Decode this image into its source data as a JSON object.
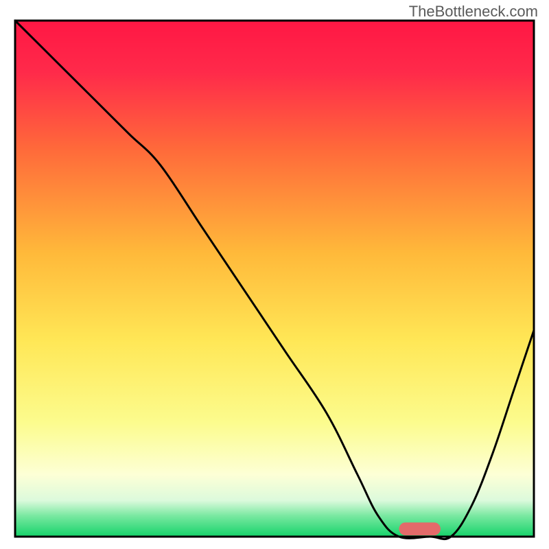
{
  "watermark": "TheBottleneck.com",
  "chart_data": {
    "type": "line",
    "title": "",
    "xlabel": "",
    "ylabel": "",
    "xlim": [
      0,
      100
    ],
    "ylim": [
      0,
      100
    ],
    "background": {
      "type": "vertical-gradient",
      "stops": [
        {
          "offset": 0.0,
          "color": "#ff1744"
        },
        {
          "offset": 0.1,
          "color": "#ff2a4a"
        },
        {
          "offset": 0.25,
          "color": "#ff6a3a"
        },
        {
          "offset": 0.45,
          "color": "#ffb93a"
        },
        {
          "offset": 0.62,
          "color": "#ffe756"
        },
        {
          "offset": 0.78,
          "color": "#fcfc8e"
        },
        {
          "offset": 0.88,
          "color": "#fdffd6"
        },
        {
          "offset": 0.93,
          "color": "#dcfadc"
        },
        {
          "offset": 0.96,
          "color": "#78e8a0"
        },
        {
          "offset": 1.0,
          "color": "#15d36a"
        }
      ]
    },
    "series": [
      {
        "name": "bottleneck-curve",
        "color": "#000000",
        "x": [
          0,
          8,
          16,
          22,
          28,
          36,
          44,
          52,
          60,
          66,
          70,
          74,
          80,
          84,
          88,
          92,
          96,
          100
        ],
        "y": [
          100,
          92,
          84,
          78,
          72,
          60,
          48,
          36,
          24,
          12,
          4,
          0,
          0,
          0,
          6,
          16,
          28,
          40
        ]
      }
    ],
    "marker": {
      "name": "optimal-range",
      "color": "#e36a6a",
      "x_start": 74,
      "x_end": 82,
      "y": 1.5,
      "thickness": 2.5
    },
    "axes": {
      "show_ticks": false,
      "show_labels": false,
      "frame_color": "#000000",
      "frame_width": 3
    }
  }
}
